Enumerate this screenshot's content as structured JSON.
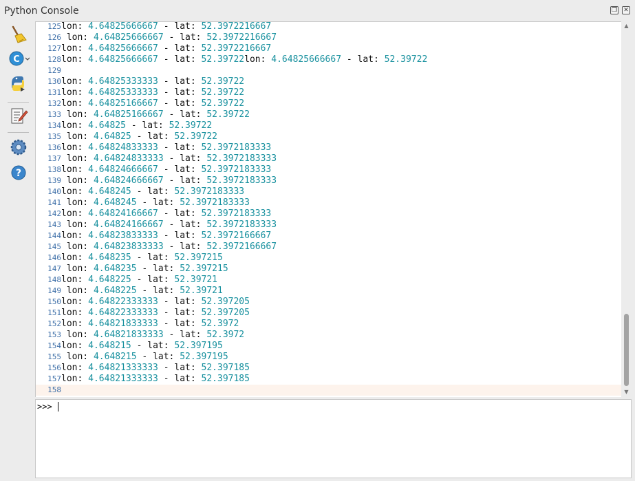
{
  "window": {
    "title": "Python Console",
    "float_glyph": "❐",
    "close_glyph": "✕"
  },
  "toolbar": {
    "items": [
      {
        "name": "clear-console-icon"
      },
      {
        "name": "import-class-icon"
      },
      {
        "name": "run-script-icon"
      },
      {
        "name": "show-editor-icon"
      },
      {
        "name": "settings-icon"
      },
      {
        "name": "help-icon"
      }
    ]
  },
  "colors": {
    "line_number": "#3e6fa8",
    "number": "#17909e",
    "text": "#111111",
    "current_line": "#fdf3ec"
  },
  "console": {
    "lines": [
      {
        "n": "125",
        "segs": [
          [
            "t",
            "lon: "
          ],
          [
            "n",
            "4.64825666667"
          ],
          [
            "t",
            " - lat: "
          ],
          [
            "n",
            "52.3972216667"
          ]
        ]
      },
      {
        "n": "126",
        "segs": [
          [
            "t",
            " lon: "
          ],
          [
            "n",
            "4.64825666667"
          ],
          [
            "t",
            " - lat: "
          ],
          [
            "n",
            "52.3972216667"
          ]
        ]
      },
      {
        "n": "127",
        "segs": [
          [
            "t",
            "lon: "
          ],
          [
            "n",
            "4.64825666667"
          ],
          [
            "t",
            " - lat: "
          ],
          [
            "n",
            "52.3972216667"
          ]
        ]
      },
      {
        "n": "128",
        "segs": [
          [
            "t",
            "lon: "
          ],
          [
            "n",
            "4.64825666667"
          ],
          [
            "t",
            " - lat: "
          ],
          [
            "n",
            "52.39722"
          ],
          [
            "t",
            "lon: "
          ],
          [
            "n",
            "4.64825666667"
          ],
          [
            "t",
            " - lat: "
          ],
          [
            "n",
            "52.39722"
          ]
        ]
      },
      {
        "n": "129",
        "segs": []
      },
      {
        "n": "130",
        "segs": [
          [
            "t",
            "lon: "
          ],
          [
            "n",
            "4.64825333333"
          ],
          [
            "t",
            " - lat: "
          ],
          [
            "n",
            "52.39722"
          ]
        ]
      },
      {
        "n": "131",
        "segs": [
          [
            "t",
            "lon: "
          ],
          [
            "n",
            "4.64825333333"
          ],
          [
            "t",
            " - lat: "
          ],
          [
            "n",
            "52.39722"
          ]
        ]
      },
      {
        "n": "132",
        "segs": [
          [
            "t",
            "lon: "
          ],
          [
            "n",
            "4.64825166667"
          ],
          [
            "t",
            " - lat: "
          ],
          [
            "n",
            "52.39722"
          ]
        ]
      },
      {
        "n": "133",
        "segs": [
          [
            "t",
            " lon: "
          ],
          [
            "n",
            "4.64825166667"
          ],
          [
            "t",
            " - lat: "
          ],
          [
            "n",
            "52.39722"
          ]
        ]
      },
      {
        "n": "134",
        "segs": [
          [
            "t",
            "lon: "
          ],
          [
            "n",
            "4.64825"
          ],
          [
            "t",
            " - lat: "
          ],
          [
            "n",
            "52.39722"
          ]
        ]
      },
      {
        "n": "135",
        "segs": [
          [
            "t",
            " lon: "
          ],
          [
            "n",
            "4.64825"
          ],
          [
            "t",
            " - lat: "
          ],
          [
            "n",
            "52.39722"
          ]
        ]
      },
      {
        "n": "136",
        "segs": [
          [
            "t",
            "lon: "
          ],
          [
            "n",
            "4.64824833333"
          ],
          [
            "t",
            " - lat: "
          ],
          [
            "n",
            "52.3972183333"
          ]
        ]
      },
      {
        "n": "137",
        "segs": [
          [
            "t",
            " lon: "
          ],
          [
            "n",
            "4.64824833333"
          ],
          [
            "t",
            " - lat: "
          ],
          [
            "n",
            "52.3972183333"
          ]
        ]
      },
      {
        "n": "138",
        "segs": [
          [
            "t",
            "lon: "
          ],
          [
            "n",
            "4.64824666667"
          ],
          [
            "t",
            " - lat: "
          ],
          [
            "n",
            "52.3972183333"
          ]
        ]
      },
      {
        "n": "139",
        "segs": [
          [
            "t",
            " lon: "
          ],
          [
            "n",
            "4.64824666667"
          ],
          [
            "t",
            " - lat: "
          ],
          [
            "n",
            "52.3972183333"
          ]
        ]
      },
      {
        "n": "140",
        "segs": [
          [
            "t",
            "lon: "
          ],
          [
            "n",
            "4.648245"
          ],
          [
            "t",
            " - lat: "
          ],
          [
            "n",
            "52.3972183333"
          ]
        ]
      },
      {
        "n": "141",
        "segs": [
          [
            "t",
            " lon: "
          ],
          [
            "n",
            "4.648245"
          ],
          [
            "t",
            " - lat: "
          ],
          [
            "n",
            "52.3972183333"
          ]
        ]
      },
      {
        "n": "142",
        "segs": [
          [
            "t",
            "lon: "
          ],
          [
            "n",
            "4.64824166667"
          ],
          [
            "t",
            " - lat: "
          ],
          [
            "n",
            "52.3972183333"
          ]
        ]
      },
      {
        "n": "143",
        "segs": [
          [
            "t",
            " lon: "
          ],
          [
            "n",
            "4.64824166667"
          ],
          [
            "t",
            " - lat: "
          ],
          [
            "n",
            "52.3972183333"
          ]
        ]
      },
      {
        "n": "144",
        "segs": [
          [
            "t",
            "lon: "
          ],
          [
            "n",
            "4.64823833333"
          ],
          [
            "t",
            " - lat: "
          ],
          [
            "n",
            "52.3972166667"
          ]
        ]
      },
      {
        "n": "145",
        "segs": [
          [
            "t",
            " lon: "
          ],
          [
            "n",
            "4.64823833333"
          ],
          [
            "t",
            " - lat: "
          ],
          [
            "n",
            "52.3972166667"
          ]
        ]
      },
      {
        "n": "146",
        "segs": [
          [
            "t",
            "lon: "
          ],
          [
            "n",
            "4.648235"
          ],
          [
            "t",
            " - lat: "
          ],
          [
            "n",
            "52.397215"
          ]
        ]
      },
      {
        "n": "147",
        "segs": [
          [
            "t",
            " lon: "
          ],
          [
            "n",
            "4.648235"
          ],
          [
            "t",
            " - lat: "
          ],
          [
            "n",
            "52.397215"
          ]
        ]
      },
      {
        "n": "148",
        "segs": [
          [
            "t",
            "lon: "
          ],
          [
            "n",
            "4.648225"
          ],
          [
            "t",
            " - lat: "
          ],
          [
            "n",
            "52.39721"
          ]
        ]
      },
      {
        "n": "149",
        "segs": [
          [
            "t",
            " lon: "
          ],
          [
            "n",
            "4.648225"
          ],
          [
            "t",
            " - lat: "
          ],
          [
            "n",
            "52.39721"
          ]
        ]
      },
      {
        "n": "150",
        "segs": [
          [
            "t",
            "lon: "
          ],
          [
            "n",
            "4.64822333333"
          ],
          [
            "t",
            " - lat: "
          ],
          [
            "n",
            "52.397205"
          ]
        ]
      },
      {
        "n": "151",
        "segs": [
          [
            "t",
            "lon: "
          ],
          [
            "n",
            "4.64822333333"
          ],
          [
            "t",
            " - lat: "
          ],
          [
            "n",
            "52.397205"
          ]
        ]
      },
      {
        "n": "152",
        "segs": [
          [
            "t",
            "lon: "
          ],
          [
            "n",
            "4.64821833333"
          ],
          [
            "t",
            " - lat: "
          ],
          [
            "n",
            "52.3972"
          ]
        ]
      },
      {
        "n": "153",
        "segs": [
          [
            "t",
            " lon: "
          ],
          [
            "n",
            "4.64821833333"
          ],
          [
            "t",
            " - lat: "
          ],
          [
            "n",
            "52.3972"
          ]
        ]
      },
      {
        "n": "154",
        "segs": [
          [
            "t",
            "lon: "
          ],
          [
            "n",
            "4.648215"
          ],
          [
            "t",
            " - lat: "
          ],
          [
            "n",
            "52.397195"
          ]
        ]
      },
      {
        "n": "155",
        "segs": [
          [
            "t",
            " lon: "
          ],
          [
            "n",
            "4.648215"
          ],
          [
            "t",
            " - lat: "
          ],
          [
            "n",
            "52.397195"
          ]
        ]
      },
      {
        "n": "156",
        "segs": [
          [
            "t",
            "lon: "
          ],
          [
            "n",
            "4.64821333333"
          ],
          [
            "t",
            " - lat: "
          ],
          [
            "n",
            "52.397185"
          ]
        ]
      },
      {
        "n": "157",
        "segs": [
          [
            "t",
            "lon: "
          ],
          [
            "n",
            "4.64821333333"
          ],
          [
            "t",
            " - lat: "
          ],
          [
            "n",
            "52.397185"
          ]
        ]
      },
      {
        "n": "158",
        "segs": []
      }
    ]
  },
  "input": {
    "prompt": ">>>",
    "value": ""
  },
  "scrollbar": {
    "position_fraction": 1.0
  }
}
